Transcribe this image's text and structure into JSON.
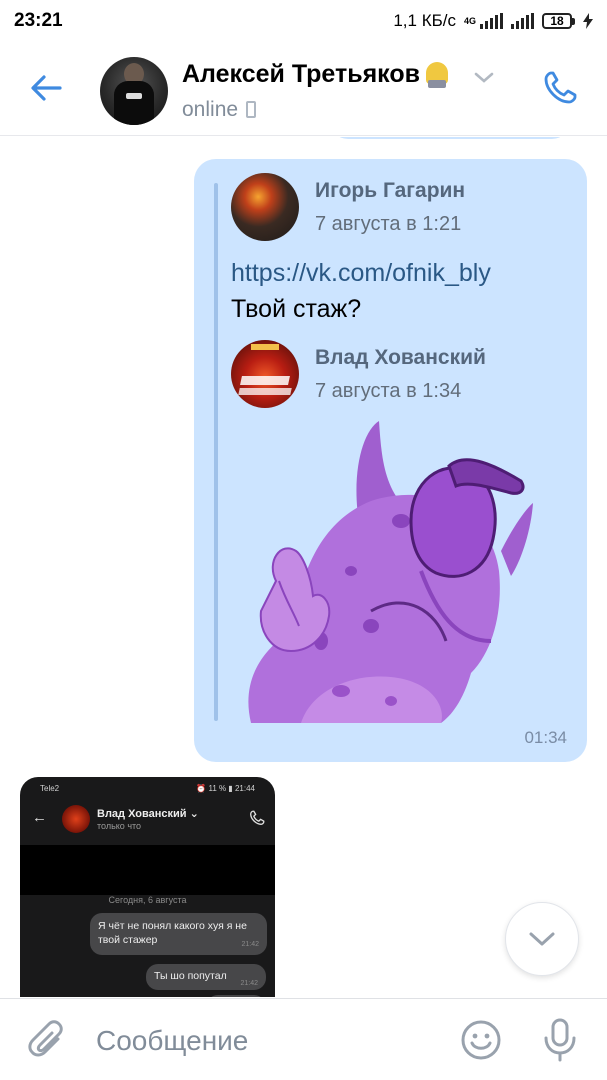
{
  "status_bar": {
    "time": "23:21",
    "speed": "1,1 КБ/с",
    "network": "4G",
    "battery": "18"
  },
  "header": {
    "contact_name": "Алексей Третьяков",
    "status": "online",
    "accent_color": "#3f8ae0"
  },
  "message": {
    "forwarded": [
      {
        "author": "Игорь Гагарин",
        "date": "7 августа в 1:21",
        "link": "https://vk.com/ofnik_bly",
        "text": "Твой стаж?"
      },
      {
        "author": "Влад Хованский",
        "date": "7 августа в 1:34",
        "sticker": "purple-monster-facepalm"
      }
    ],
    "time": "01:34",
    "bubble_color": "#cce4ff"
  },
  "attachment_screenshot": {
    "status_left": "Tele2",
    "status_right": "⏰ 11 % ▮ 21:44",
    "contact_name": "Влад Хованский",
    "contact_status": "только что",
    "day_separator": "Сегодня, 6 августа",
    "messages": [
      {
        "text": "Я чёт не понял какого хуя я не твой стажер",
        "time": "21:42"
      },
      {
        "text": "Ты шо попутал",
        "time": "21:42"
      }
    ]
  },
  "composer": {
    "placeholder": "Сообщение"
  }
}
